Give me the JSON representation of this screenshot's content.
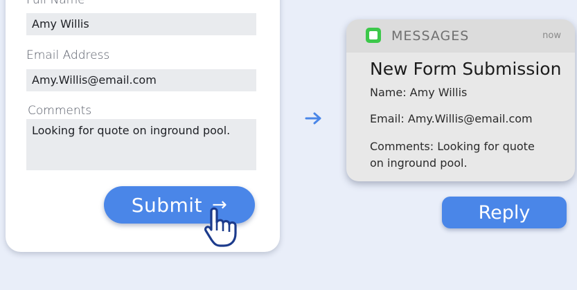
{
  "form": {
    "full_name_label": "Full Name",
    "full_name_value": "Amy Willis",
    "email_label": "Email Address",
    "email_value": "Amy.Willis@email.com",
    "comments_label": "Comments",
    "comments_value": "Looking for quote on inground pool.",
    "submit_label": "Submit",
    "submit_arrow": "→"
  },
  "flow_arrow_icon": "arrow-right-icon",
  "notification": {
    "app_name": "MESSAGES",
    "time": "now",
    "title": "New Form Submission",
    "name_line": "Name: Amy Willis",
    "email_line": "Email: Amy.Willis@email.com",
    "comments_line_1": "Comments: Looking for quote",
    "comments_line_2": "on inground pool.",
    "reply_label": "Reply"
  },
  "colors": {
    "background": "#e9eef9",
    "accent": "#4a86e8",
    "messages_green": "#3cc84a"
  }
}
